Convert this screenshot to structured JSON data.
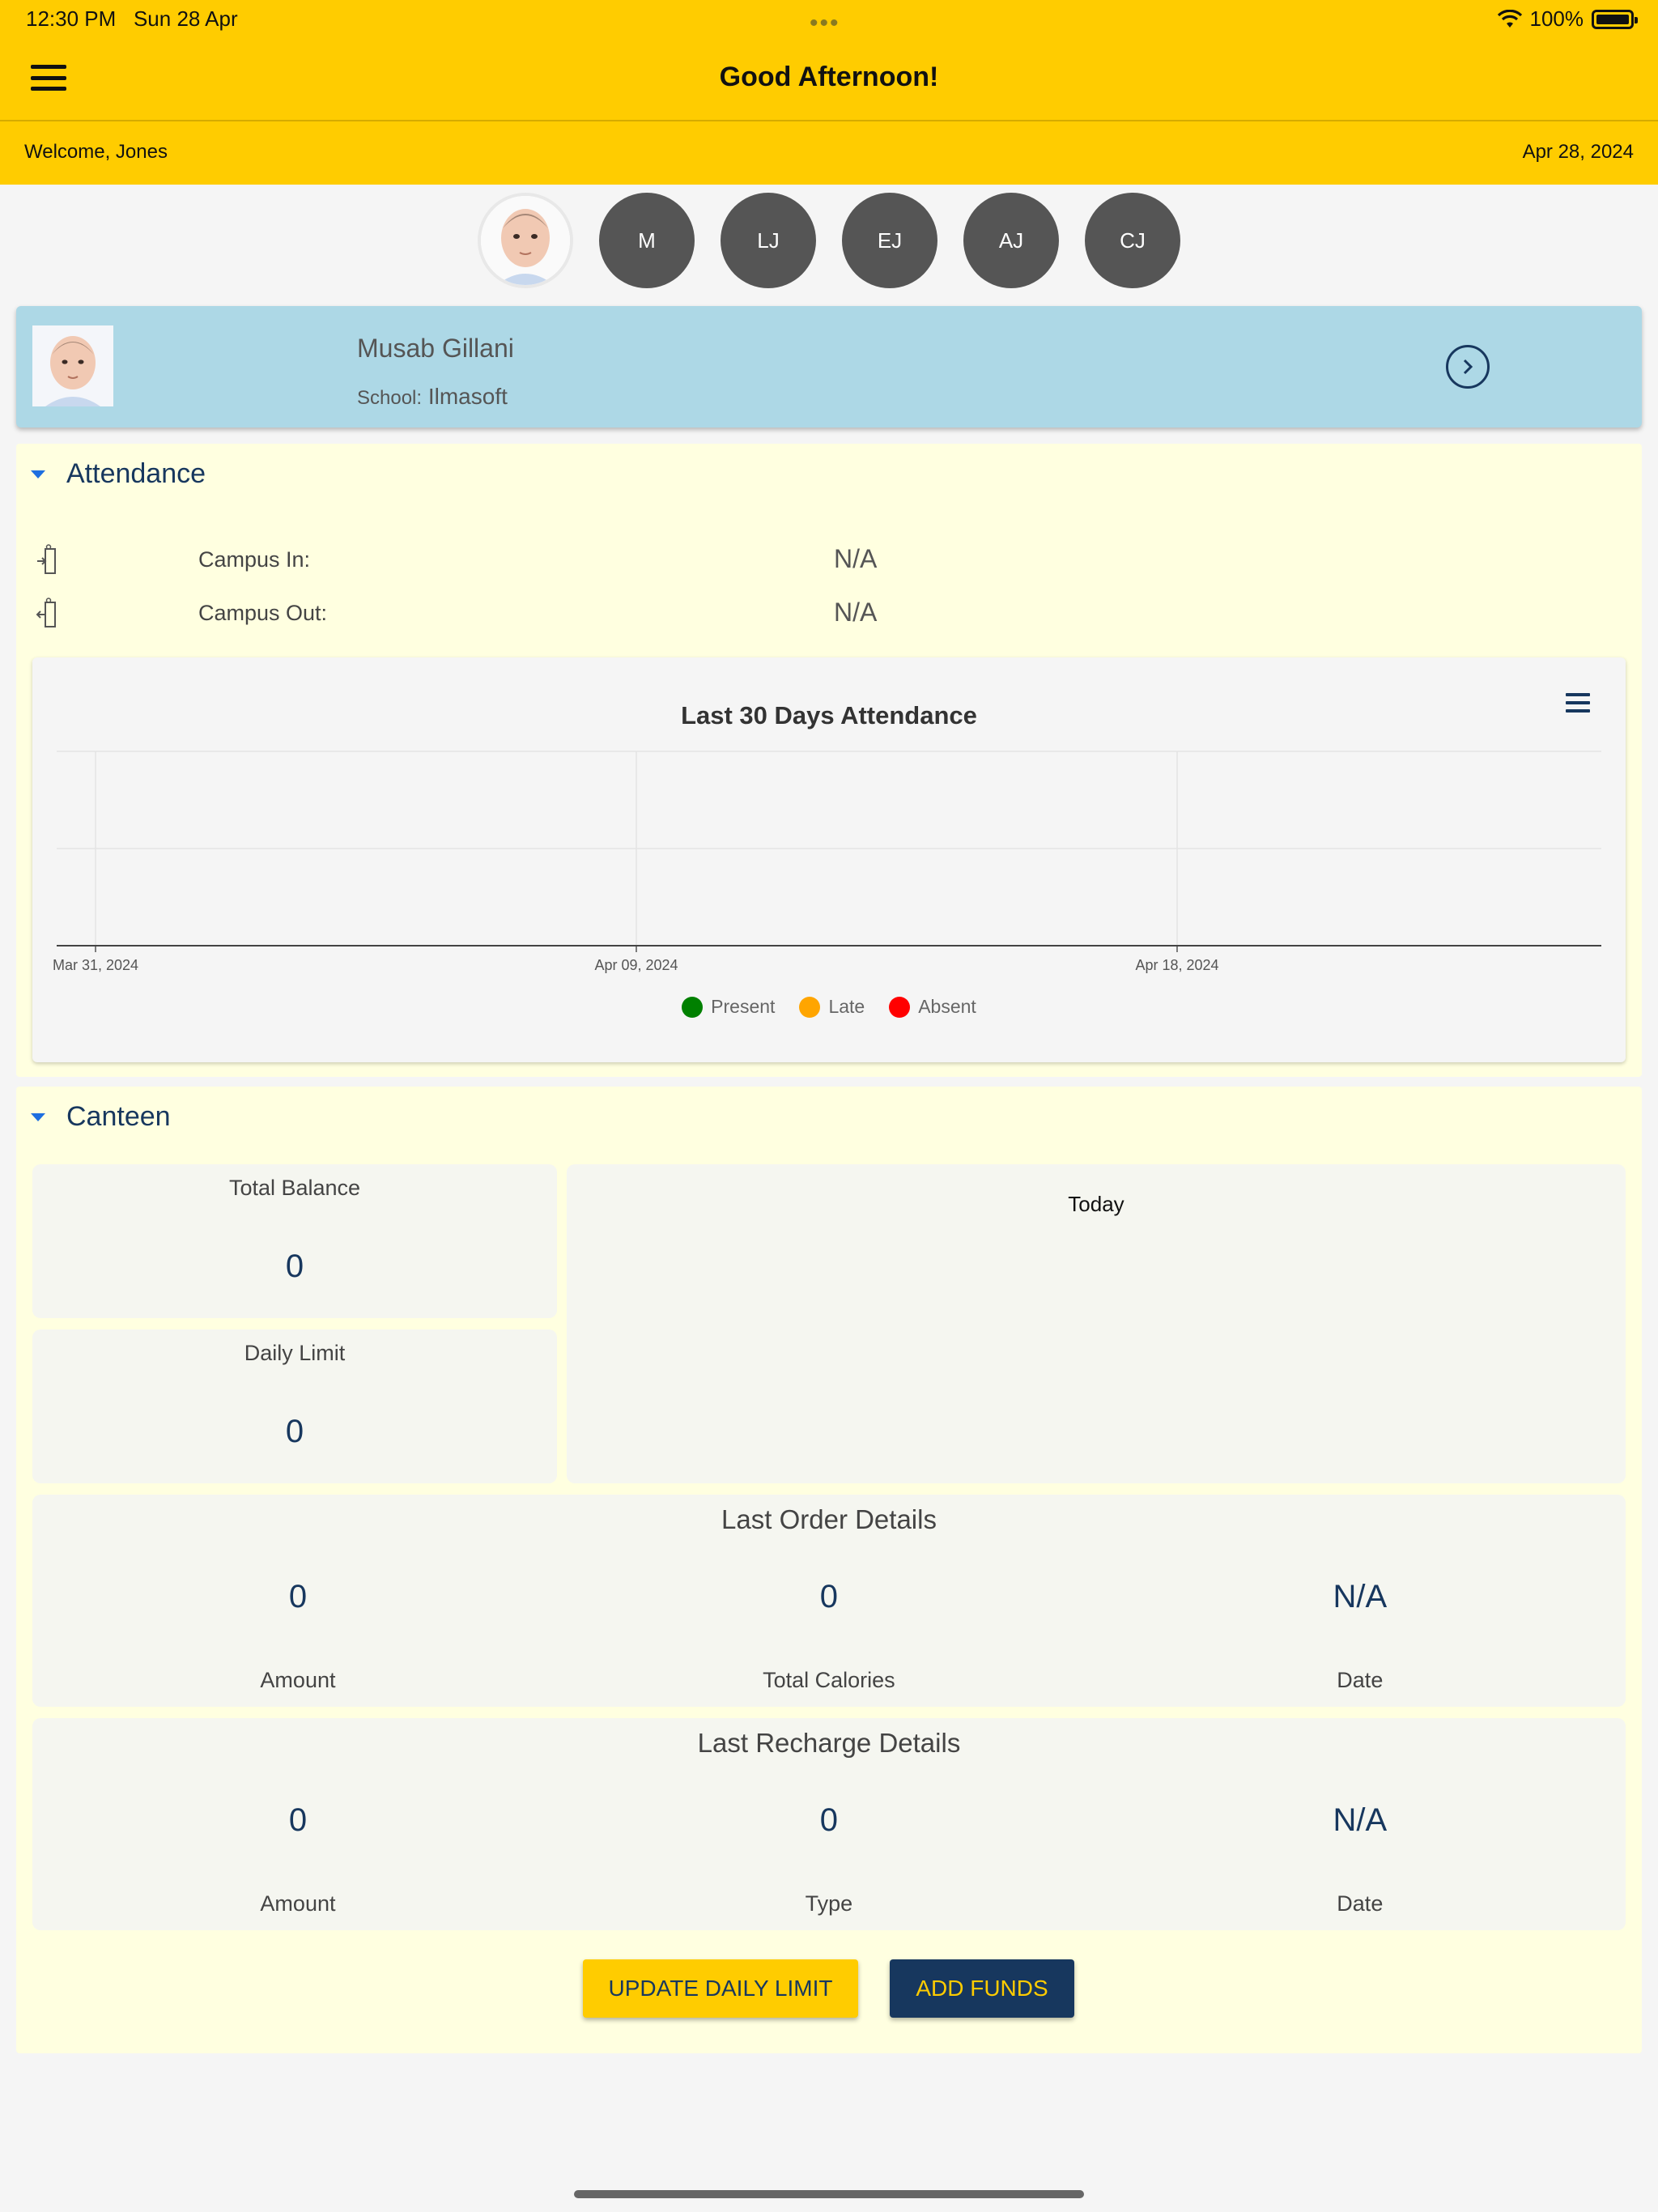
{
  "status_bar": {
    "time": "12:30 PM",
    "date": "Sun 28 Apr",
    "dots": "•••",
    "battery": "100%"
  },
  "header": {
    "title": "Good Afternoon!",
    "welcome": "Welcome, Jones",
    "date": "Apr 28, 2024"
  },
  "children": [
    {
      "initials": "",
      "type": "photo"
    },
    {
      "initials": "M"
    },
    {
      "initials": "LJ"
    },
    {
      "initials": "EJ"
    },
    {
      "initials": "AJ"
    },
    {
      "initials": "CJ"
    }
  ],
  "student": {
    "name": "Musab Gillani",
    "school_label": "School:",
    "school": "Ilmasoft"
  },
  "attendance": {
    "title": "Attendance",
    "campus_in_label": "Campus In:",
    "campus_in_value": "N/A",
    "campus_out_label": "Campus Out:",
    "campus_out_value": "N/A"
  },
  "chart_data": {
    "type": "line",
    "title": "Last 30 Days Attendance",
    "x_ticks": [
      "Mar 31, 2024",
      "Apr 09, 2024",
      "Apr 18, 2024"
    ],
    "series": [
      {
        "name": "Present",
        "values": [],
        "color": "#008000"
      },
      {
        "name": "Late",
        "values": [],
        "color": "#ffa500"
      },
      {
        "name": "Absent",
        "values": [],
        "color": "#ff0000"
      }
    ],
    "grid": true,
    "legend_placement": "bottom-center"
  },
  "canteen": {
    "title": "Canteen",
    "total_balance_label": "Total Balance",
    "total_balance_value": "0",
    "daily_limit_label": "Daily Limit",
    "daily_limit_value": "0",
    "today_label": "Today",
    "last_order": {
      "title": "Last Order Details",
      "amount_value": "0",
      "amount_label": "Amount",
      "calories_value": "0",
      "calories_label": "Total Calories",
      "date_value": "N/A",
      "date_label": "Date"
    },
    "last_recharge": {
      "title": "Last Recharge Details",
      "amount_value": "0",
      "amount_label": "Amount",
      "type_value": "0",
      "type_label": "Type",
      "date_value": "N/A",
      "date_label": "Date"
    },
    "update_limit_button": "UPDATE DAILY LIMIT",
    "add_funds_button": "ADD FUNDS"
  },
  "colors": {
    "brand_yellow": "#ffcc00",
    "navy": "#17375e",
    "card_blue": "#add8e6",
    "section_bg": "#ffffe0"
  }
}
